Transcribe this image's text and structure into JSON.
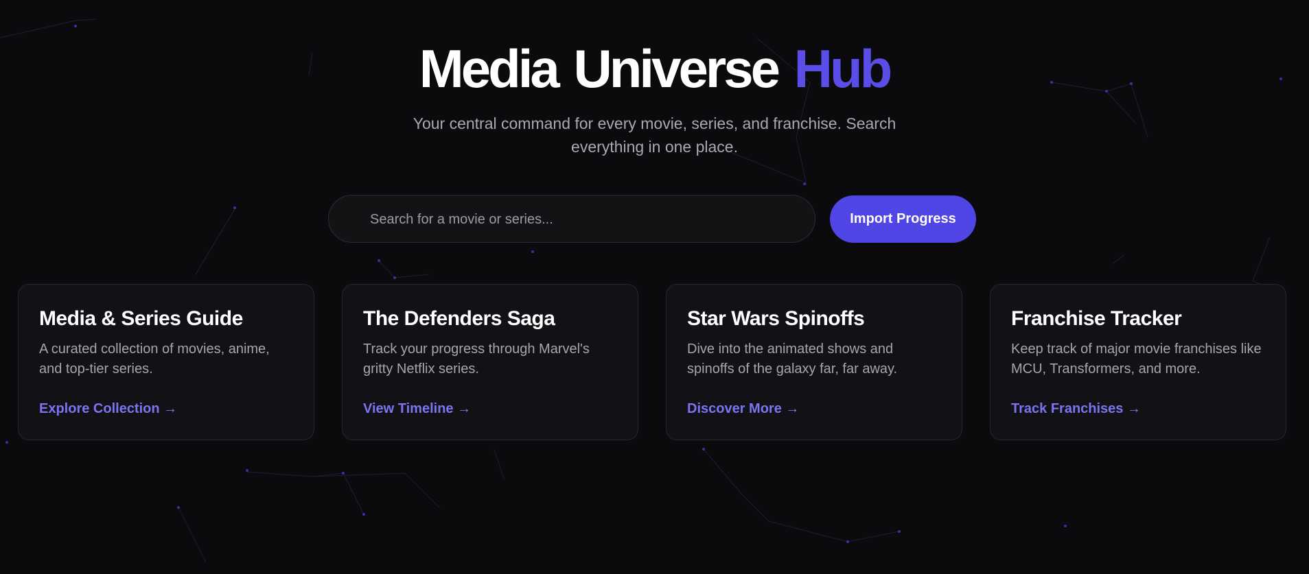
{
  "hero": {
    "title_main": "Media Universe",
    "title_accent": "Hub",
    "subtitle": "Your central command for every movie, series, and franchise. Search everything in one place."
  },
  "search": {
    "placeholder": "Search for a movie or series...",
    "value": ""
  },
  "actions": {
    "import_label": "Import Progress"
  },
  "cards": [
    {
      "title": "Media & Series Guide",
      "description": "A curated collection of movies, anime, and top-tier series.",
      "link": "Explore Collection →"
    },
    {
      "title": "The Defenders Saga",
      "description": "Track your progress through Marvel's gritty Netflix series.",
      "link": "View Timeline →"
    },
    {
      "title": "Star Wars Spinoffs",
      "description": "Dive into the animated shows and spinoffs of the galaxy far, far away.",
      "link": "Discover More →"
    },
    {
      "title": "Franchise Tracker",
      "description": "Keep track of major movie franchises like MCU, Transformers, and more.",
      "link": "Track Franchises →"
    }
  ],
  "colors": {
    "background": "#0b0b0d",
    "accent": "#4f46e5",
    "accent_text": "#5b4ee8",
    "link": "#7c74f0",
    "card_bg": "#121216",
    "muted_text": "#a6a6b0"
  }
}
